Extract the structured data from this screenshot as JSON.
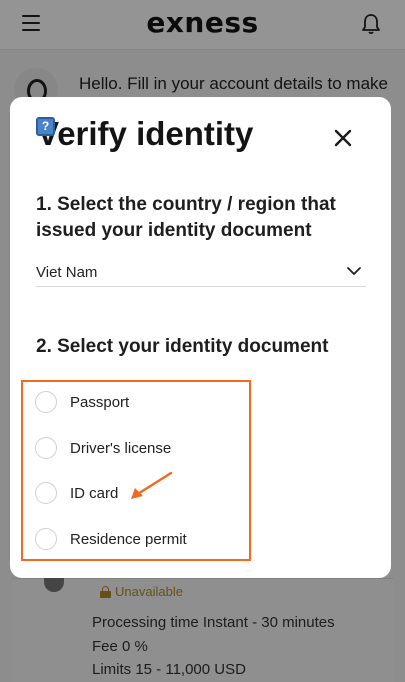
{
  "header": {
    "logo_text": "exness",
    "menu_icon": "hamburger-menu-icon",
    "bell_icon": "bell-icon"
  },
  "background": {
    "greeting": "Hello. Fill in your account details to make",
    "unavailable_label": "Unavailable",
    "processing_time": "Processing time Instant - 30 minutes",
    "fee": "Fee 0 %",
    "limits": "Limits 15 - 11,000 USD"
  },
  "modal": {
    "title": "Verify identity",
    "close_icon": "close-icon",
    "step1_title": "1. Select the country / region that issued your identity document",
    "country_value": "Viet Nam",
    "step2_title": "2. Select your identity document",
    "documents": [
      {
        "label": "Passport",
        "selected": false
      },
      {
        "label": "Driver's license",
        "selected": false
      },
      {
        "label": "ID card",
        "selected": false
      },
      {
        "label": "Residence permit",
        "selected": false
      }
    ]
  },
  "colors": {
    "highlight": "#f06a1f",
    "overlay": "rgba(0,0,0,0.42)",
    "warning": "#b08a2c"
  }
}
